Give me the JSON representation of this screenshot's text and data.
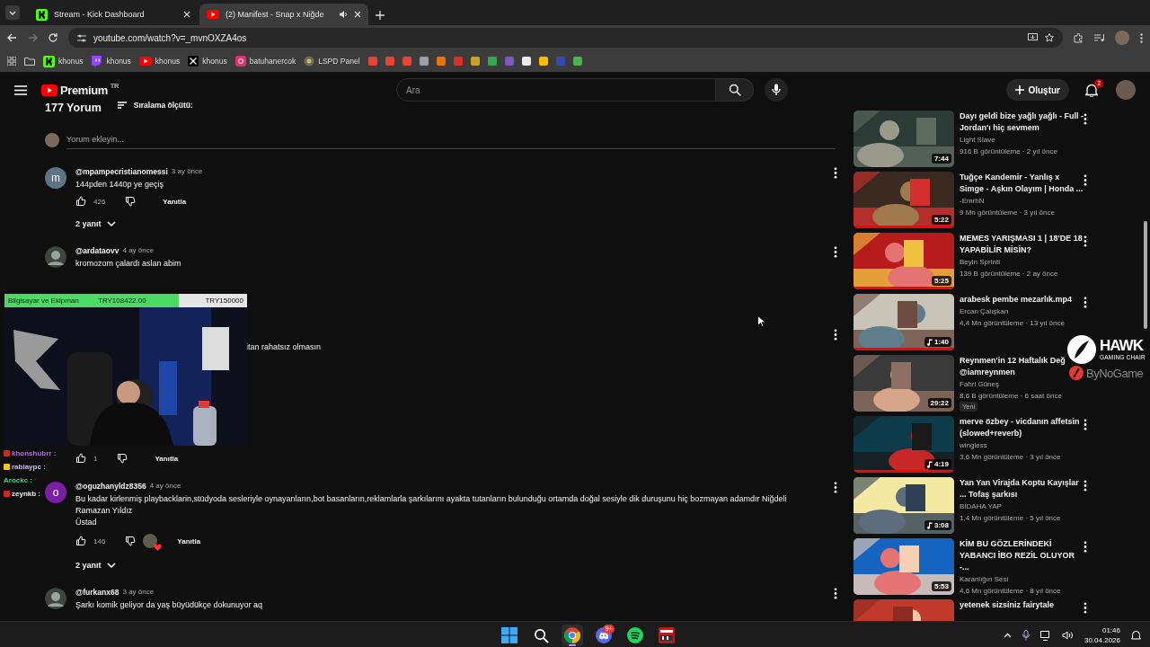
{
  "browser": {
    "tabs": [
      {
        "title": "Stream - Kick Dashboard",
        "kind": "kick",
        "selected": false,
        "audio": false
      },
      {
        "title": "(2) Manifest - Snap x Niğde",
        "kind": "youtube",
        "selected": true,
        "audio": true
      }
    ],
    "url": "youtube.com/watch?v=_mvnOXZA4os",
    "bookmarks": [
      {
        "kind": "kick",
        "label": "khonus"
      },
      {
        "kind": "twitch",
        "label": "khonus"
      },
      {
        "kind": "youtube",
        "label": "khonus"
      },
      {
        "kind": "x",
        "label": "khonus"
      },
      {
        "kind": "instagram",
        "label": "batuhanercok"
      },
      {
        "kind": "badge",
        "label": "LSPD Panel"
      },
      {
        "kind": "icon",
        "color": "#ea4335"
      },
      {
        "kind": "icon",
        "color": "#ea4335"
      },
      {
        "kind": "icon",
        "color": "#ea4335"
      },
      {
        "kind": "icon",
        "color": "#9aa0a6"
      },
      {
        "kind": "icon",
        "color": "#e8710a"
      },
      {
        "kind": "icon",
        "color": "#d93025"
      },
      {
        "kind": "icon",
        "color": "#c9a227"
      },
      {
        "kind": "icon",
        "color": "#34a853"
      },
      {
        "kind": "icon",
        "color": "#7e57c2"
      },
      {
        "kind": "icon",
        "color": "#e8eaed"
      },
      {
        "kind": "icon",
        "color": "#fbbc04"
      },
      {
        "kind": "icon",
        "color": "#3949ab"
      },
      {
        "kind": "icon",
        "color": "#4caf50"
      }
    ]
  },
  "youtube": {
    "logo": "Premium",
    "region": "TR",
    "search": {
      "placeholder": "Ara"
    },
    "create": "Oluştur",
    "notifications": "2",
    "comments": {
      "count": "177 Yorum",
      "sort": "Sıralama ölçütü:",
      "add_placeholder": "Yorum ekleyin...",
      "items": [
        {
          "kind": "full",
          "avatar": "m",
          "color": "#5f7482",
          "author": "@mpampecristianomessi",
          "time": "3 ay önce",
          "text": [
            "144pden 1440p ye geçiş"
          ],
          "likes": "426",
          "reply": "Yanıtla",
          "hearted": false,
          "replies": "2 yanıt"
        },
        {
          "kind": "partial",
          "author": "@ardataovv",
          "time": "4 ay önce",
          "text": [
            "kromozom çalardı aslan abim"
          ]
        },
        {
          "kind": "occluded",
          "text": [
            "itan rahatsız olmasın"
          ],
          "likes": "1",
          "reply": "Yanıtla"
        },
        {
          "kind": "full",
          "avatar": "o",
          "color": "#7b1fa2",
          "author": "@oguzhanyldz8356",
          "time": "4 ay önce",
          "text": [
            "Bu kadar kirlenmiş playbacklarin,stüdyoda sesleriyle oynayanların,bot basanların,reklamlarla şarkılarını ayakta tutanların bulunduğu ortamda doğal sesiyle dik duruşunu hiç bozmayan adamdır Niğdeli Ramazan Yıldız",
            "Üstad"
          ],
          "likes": "146",
          "reply": "Yanıtla",
          "hearted": true,
          "replies": "2 yanıt"
        },
        {
          "kind": "partial",
          "author": "@furkanx68",
          "time": "3 ay önce",
          "text": [
            "Şarkı komik geliyor da yaş büyüdükçe dokunuyor aq"
          ]
        }
      ]
    },
    "related": [
      {
        "title": "Dayı geldi bize yağlı yağlı - Full - Jordan'ı hiç sevmem",
        "channel": "Light Slave",
        "meta": "916 B görüntüleme · 2 yıl önce",
        "duration": "7:44",
        "music": false,
        "watched": false,
        "menu": true
      },
      {
        "title": "Tuğçe Kandemir - Yanlış x Simge - Aşkın Olayım | Honda ...",
        "channel": "-EmrhN",
        "meta": "9 Mn görüntüleme · 3 yıl önce",
        "duration": "5:22",
        "music": false,
        "watched": true,
        "menu": true
      },
      {
        "title": "MEMES YARIŞMASI 1 | 18'DE 18 YAPABİLİR MİSİN?",
        "channel": "Beyin Sprinti",
        "meta": "139 B görüntüleme · 2 ay önce",
        "duration": "5:25",
        "music": false,
        "watched": true,
        "menu": true
      },
      {
        "title": "arabesk pembe mezarlık.mp4",
        "channel": "Ercan Çalışkan",
        "meta": "4,4 Mn görüntüleme · 13 yıl önce",
        "duration": "1:40",
        "music": true,
        "watched": true,
        "menu": true
      },
      {
        "title": "Reynmen'in 12 Haftalık Değ",
        "title_2": "@iamreynmen",
        "channel": "Fahri Güneş",
        "meta": "8,6 B görüntüleme · 6 saat önce",
        "duration": "29:22",
        "music": false,
        "watched": false,
        "menu": false,
        "badge": "Yeni"
      },
      {
        "title": "merve özbey - vicdanın affetsin (slowed+reverb)",
        "channel": "wingless",
        "meta": "3,6 Mn görüntüleme · 3 yıl önce",
        "duration": "4:19",
        "music": true,
        "watched": true,
        "menu": true
      },
      {
        "title": "Yan Yan Virajda Koptu Kayışlar ... Tofaş şarkısı",
        "channel": "BİDAHA YAP",
        "meta": "1,4 Mn görüntüleme · 5 yıl önce",
        "duration": "3:08",
        "music": true,
        "watched": false,
        "menu": true
      },
      {
        "title": "KİM BU GÖZLERİNDEKİ YABANCI İBO REZİL OLUYOR -...",
        "channel": "Karanlığın Sesi",
        "meta": "4,6 Mn görüntüleme · 8 yıl önce",
        "duration": "5:53",
        "music": false,
        "watched": false,
        "menu": true
      },
      {
        "title": "yetenek sizsiniz fairytale",
        "menu": true
      }
    ]
  },
  "stream_overlay": {
    "goal": {
      "label": "Bilgisayar ve Ekipman",
      "current": "TRY108422.00",
      "target": "TRY150000",
      "level": 0.72
    },
    "chat": [
      {
        "name": "khonshubrr :",
        "color": "#b36be0",
        "badge": {
          "color": "#c62828"
        }
      },
      {
        "name": "rabiaypc :",
        "color": "#c8b8f0",
        "badge": {
          "color": "#f0c419"
        }
      },
      {
        "name": "Arockc :",
        "color": "#3ccf8e"
      },
      {
        "name": "zeynkb :",
        "color": "#eeeeee",
        "badge": {
          "color": "#c62828"
        }
      }
    ],
    "sponsors": {
      "brand": "HAWK",
      "tagline": "GAMING CHAIR",
      "second": "ByNoGame"
    }
  },
  "taskbar": {
    "apps": [
      {
        "kind": "windows",
        "selected": false
      },
      {
        "kind": "search",
        "selected": false
      },
      {
        "kind": "chrome",
        "selected": true
      },
      {
        "kind": "discord",
        "selected": false,
        "badge": "9+"
      },
      {
        "kind": "spotify",
        "selected": false
      },
      {
        "kind": "voicemeeter",
        "selected": false
      }
    ],
    "time": "01:46",
    "date": "30.04.2026"
  }
}
